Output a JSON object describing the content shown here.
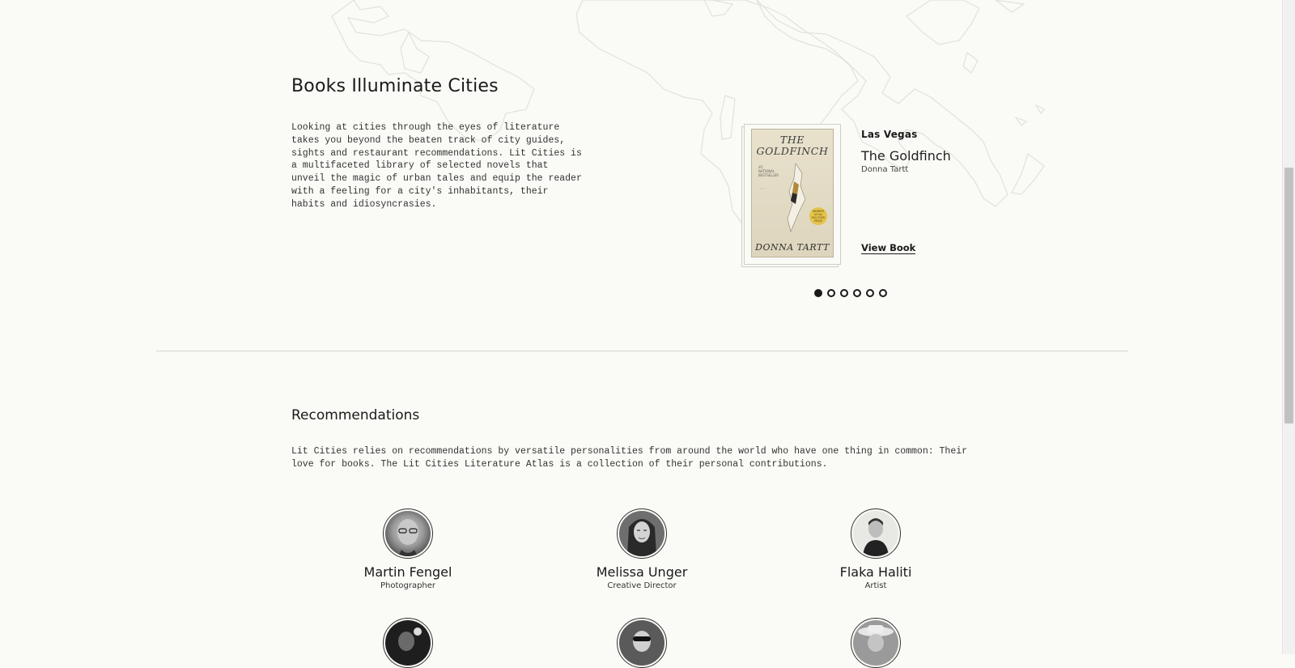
{
  "intro": {
    "title": "Books Illuminate Cities",
    "text": "Looking at cities through the eyes of literature takes you beyond the beaten track of city guides, sights and restaurant recommendations. Lit Cities is a multifaceted library of selected novels that unveil the magic of urban tales and equip the reader with a feeling for a city's inhabitants, their habits and idiosyncrasies."
  },
  "featured_book": {
    "city": "Las Vegas",
    "title": "The Goldfinch",
    "author": "Donna Tartt",
    "link_label": "View Book",
    "cover": {
      "title_line1": "THE",
      "title_line2": "GOLDFINCH",
      "tag": "#1 NATIONAL BESTSELLER",
      "seal": "WINNER of the PULITZER PRIZE",
      "author": "DONNA TARTT"
    },
    "carousel": {
      "total": 6,
      "active_index": 0
    }
  },
  "recommendations": {
    "title": "Recommendations",
    "text": "Lit Cities relies on recommendations by versatile personalities from around the world who have one thing in common: Their love for books. The Lit Cities Literature Atlas is a collection of their personal contributions.",
    "people": [
      {
        "name": "Martin Fengel",
        "role": "Photographer"
      },
      {
        "name": "Melissa Unger",
        "role": "Creative Director"
      },
      {
        "name": "Flaka Haliti",
        "role": "Artist"
      }
    ]
  },
  "colors": {
    "background": "#fafaf6",
    "text": "#1a1a1a",
    "map_lines": "#e2e2dc",
    "cover_seal": "#e4c34a"
  }
}
